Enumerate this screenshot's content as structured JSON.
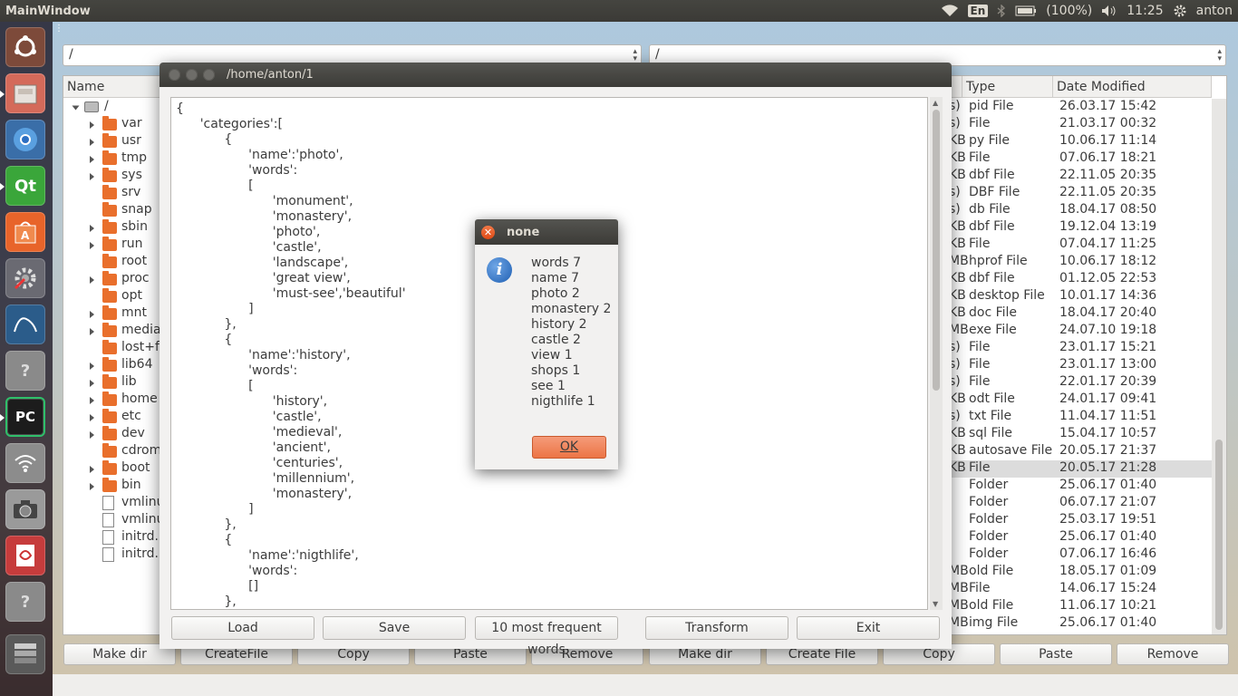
{
  "panel": {
    "window_title": "MainWindow",
    "keyboard": "En",
    "battery": "(100%)",
    "time": "11:25",
    "user": "anton"
  },
  "launcher": {
    "items": [
      "ubuntu-icon",
      "files-icon",
      "chromium-icon",
      "qt-creator-icon",
      "software-center-icon",
      "system-settings-icon",
      "mysql-workbench-icon",
      "unknown-app-icon",
      "pycharm-icon",
      "network-icon",
      "camera-icon",
      "document-viewer-icon",
      "unknown-app-icon",
      "workspace-switcher-icon"
    ]
  },
  "left_pane": {
    "path": "/",
    "column_name": "Name",
    "root": "/",
    "items": [
      {
        "label": "var",
        "type": "folder",
        "expandable": true
      },
      {
        "label": "usr",
        "type": "folder",
        "expandable": true
      },
      {
        "label": "tmp",
        "type": "folder",
        "expandable": true
      },
      {
        "label": "sys",
        "type": "folder",
        "expandable": true
      },
      {
        "label": "srv",
        "type": "folder",
        "expandable": false
      },
      {
        "label": "snap",
        "type": "folder",
        "expandable": false
      },
      {
        "label": "sbin",
        "type": "folder",
        "expandable": true
      },
      {
        "label": "run",
        "type": "folder",
        "expandable": true
      },
      {
        "label": "root",
        "type": "folder",
        "expandable": false
      },
      {
        "label": "proc",
        "type": "folder",
        "expandable": true
      },
      {
        "label": "opt",
        "type": "folder",
        "expandable": false
      },
      {
        "label": "mnt",
        "type": "folder",
        "expandable": true
      },
      {
        "label": "media",
        "type": "folder",
        "expandable": true
      },
      {
        "label": "lost+fo",
        "type": "folder",
        "expandable": false
      },
      {
        "label": "lib64",
        "type": "folder",
        "expandable": true
      },
      {
        "label": "lib",
        "type": "folder",
        "expandable": true
      },
      {
        "label": "home",
        "type": "folder",
        "expandable": true
      },
      {
        "label": "etc",
        "type": "folder",
        "expandable": true
      },
      {
        "label": "dev",
        "type": "folder",
        "expandable": true
      },
      {
        "label": "cdrom",
        "type": "folder",
        "expandable": false
      },
      {
        "label": "boot",
        "type": "folder",
        "expandable": true
      },
      {
        "label": "bin",
        "type": "folder",
        "expandable": true
      },
      {
        "label": "vmlinu",
        "type": "file",
        "expandable": false
      },
      {
        "label": "vmlinu",
        "type": "file",
        "expandable": false
      },
      {
        "label": "initrd.i",
        "type": "file",
        "expandable": false
      },
      {
        "label": "initrd.i",
        "type": "file",
        "expandable": false
      }
    ],
    "buttons": [
      "Make dir",
      "CreateFile",
      "Copy",
      "Paste",
      "Remove"
    ]
  },
  "right_pane": {
    "path": "/",
    "column_type": "Type",
    "column_date": "Date Modified",
    "rows": [
      {
        "size": "s)",
        "type": "pid File",
        "date": "26.03.17 15:42"
      },
      {
        "size": "s)",
        "type": "File",
        "date": "21.03.17 00:32"
      },
      {
        "size": "KB",
        "type": "py File",
        "date": "10.06.17 11:14"
      },
      {
        "size": "KB",
        "type": "File",
        "date": "07.06.17 18:21"
      },
      {
        "size": "KB",
        "type": "dbf File",
        "date": "22.11.05 20:35"
      },
      {
        "size": "s)",
        "type": "DBF File",
        "date": "22.11.05 20:35"
      },
      {
        "size": "s)",
        "type": "db File",
        "date": "18.04.17 08:50"
      },
      {
        "size": "KB",
        "type": "dbf File",
        "date": "19.12.04 13:19"
      },
      {
        "size": "KB",
        "type": "File",
        "date": "07.04.17 11:25"
      },
      {
        "size": "MB",
        "type": "hprof File",
        "date": "10.06.17 18:12"
      },
      {
        "size": "KB",
        "type": "dbf File",
        "date": "01.12.05 22:53"
      },
      {
        "size": "KB",
        "type": "desktop File",
        "date": "10.01.17 14:36"
      },
      {
        "size": "KB",
        "type": "doc File",
        "date": "18.04.17 20:40"
      },
      {
        "size": "MB",
        "type": "exe File",
        "date": "24.07.10 19:18"
      },
      {
        "size": "s)",
        "type": "File",
        "date": "23.01.17 15:21"
      },
      {
        "size": "s)",
        "type": "File",
        "date": "23.01.17 13:00"
      },
      {
        "size": "s)",
        "type": "File",
        "date": "22.01.17 20:39"
      },
      {
        "size": "KB",
        "type": "odt File",
        "date": "24.01.17 09:41"
      },
      {
        "size": "s)",
        "type": "txt File",
        "date": "11.04.17 11:51"
      },
      {
        "size": "KB",
        "type": "sql File",
        "date": "15.04.17 10:57"
      },
      {
        "size": "KB",
        "type": "autosave File",
        "date": "20.05.17 21:37"
      },
      {
        "size": "KB",
        "type": "File",
        "date": "20.05.17 21:28"
      },
      {
        "size": "",
        "type": "Folder",
        "date": "25.06.17 01:40"
      },
      {
        "size": "",
        "type": "Folder",
        "date": "06.07.17 21:07"
      },
      {
        "size": "",
        "type": "Folder",
        "date": "25.03.17 19:51"
      },
      {
        "size": "",
        "type": "Folder",
        "date": "25.06.17 01:40"
      },
      {
        "size": "",
        "type": "Folder",
        "date": "07.06.17 16:46"
      },
      {
        "size": "MB",
        "type": "old File",
        "date": "18.05.17 01:09"
      },
      {
        "size": "MB",
        "type": "File",
        "date": "14.06.17 15:24"
      },
      {
        "size": "MB",
        "type": "old File",
        "date": "11.06.17 10:21"
      },
      {
        "size": "MB",
        "type": "img File",
        "date": "25.06.17 01:40"
      }
    ],
    "selected_index": 21,
    "buttons": [
      "Make dir",
      "Create File",
      "Copy",
      "Paste",
      "Remove"
    ]
  },
  "editor": {
    "title": "/home/anton/1",
    "text": "{\n      'categories':[\n            {\n                  'name':'photo',\n                  'words':\n                  [\n                        'monument',\n                        'monastery',\n                        'photo',\n                        'castle',\n                        'landscape',\n                        'great view',\n                        'must-see','beautiful'\n                  ]\n            },\n            {\n                  'name':'history',\n                  'words':\n                  [\n                        'history',\n                        'castle',\n                        'medieval',\n                        'ancient',\n                        'centuries',\n                        'millennium',\n                        'monastery',\n                  ]\n            },\n            {\n                  'name':'nigthlife',\n                  'words':\n                  []\n            },",
    "buttons": [
      "Load",
      "Save",
      "10 most frequent words",
      "Transform",
      "Exit"
    ]
  },
  "message_box": {
    "title": "none",
    "lines": [
      "words 7",
      "name 7",
      "photo 2",
      "monastery 2",
      "history 2",
      "castle 2",
      "view 1",
      "shops 1",
      "see 1",
      "nigthlife 1"
    ],
    "ok_label": "OK"
  }
}
